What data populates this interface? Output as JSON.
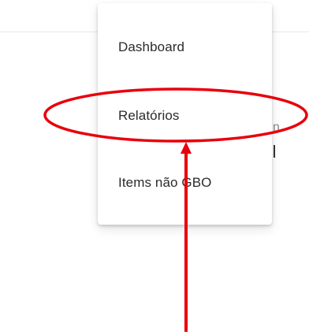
{
  "menu": {
    "items": [
      {
        "label": "Dashboard"
      },
      {
        "label": "Relatórios"
      },
      {
        "label": "Items não GBO"
      }
    ]
  },
  "background": {
    "fragment_text": "n"
  },
  "annotation": {
    "color": "#e8000b",
    "shapes": [
      "ellipse",
      "arrow"
    ]
  }
}
